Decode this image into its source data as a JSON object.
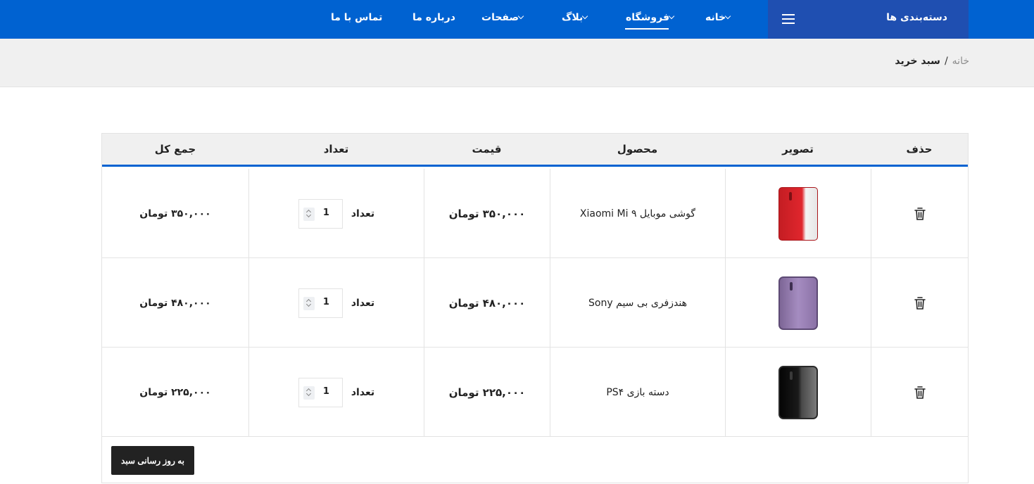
{
  "nav": {
    "categories_label": "دسته‌بندی ها",
    "items": [
      {
        "label": "خانه",
        "has_dropdown": true
      },
      {
        "label": "فروشگاه",
        "has_dropdown": true,
        "active": true
      },
      {
        "label": "بلاگ",
        "has_dropdown": true
      },
      {
        "label": "صفحات",
        "has_dropdown": true
      },
      {
        "label": "درباره ما",
        "has_dropdown": false
      },
      {
        "label": "تماس با ما",
        "has_dropdown": false
      }
    ]
  },
  "breadcrumb": {
    "home": "خانه",
    "separator": "/",
    "current": "سبد خرید"
  },
  "cart": {
    "headers": {
      "remove": "حذف",
      "image": "تصویر",
      "product": "محصول",
      "price": "قیمت",
      "quantity": "تعداد",
      "total": "جمع کل"
    },
    "rows": [
      {
        "product": "گوشی موبایل Xiaomi Mi ۹",
        "price": "۳۵۰,۰۰۰ تومان",
        "qty_label": "تعداد",
        "qty": "1",
        "total": "۳۵۰,۰۰۰ تومان",
        "image": "red-phone"
      },
      {
        "product": "هندزفری بی سیم Sony",
        "price": "۴۸۰,۰۰۰ تومان",
        "qty_label": "تعداد",
        "qty": "1",
        "total": "۴۸۰,۰۰۰ تومان",
        "image": "purple-phone"
      },
      {
        "product": "دسته بازی PS۴",
        "price": "۲۲۵,۰۰۰ تومان",
        "qty_label": "تعداد",
        "qty": "1",
        "total": "۲۲۵,۰۰۰ تومان",
        "image": "black-phone"
      }
    ],
    "update_button": "به روز رسانی سبد"
  },
  "colors": {
    "primary": "#0062d1",
    "category_box": "#1f4fb1",
    "button_dark": "#222222"
  },
  "icons": {
    "menu": "hamburger-icon",
    "remove": "trash-icon",
    "dropdown": "chevron-down-icon",
    "spinner": "spinner-arrows-icon"
  }
}
